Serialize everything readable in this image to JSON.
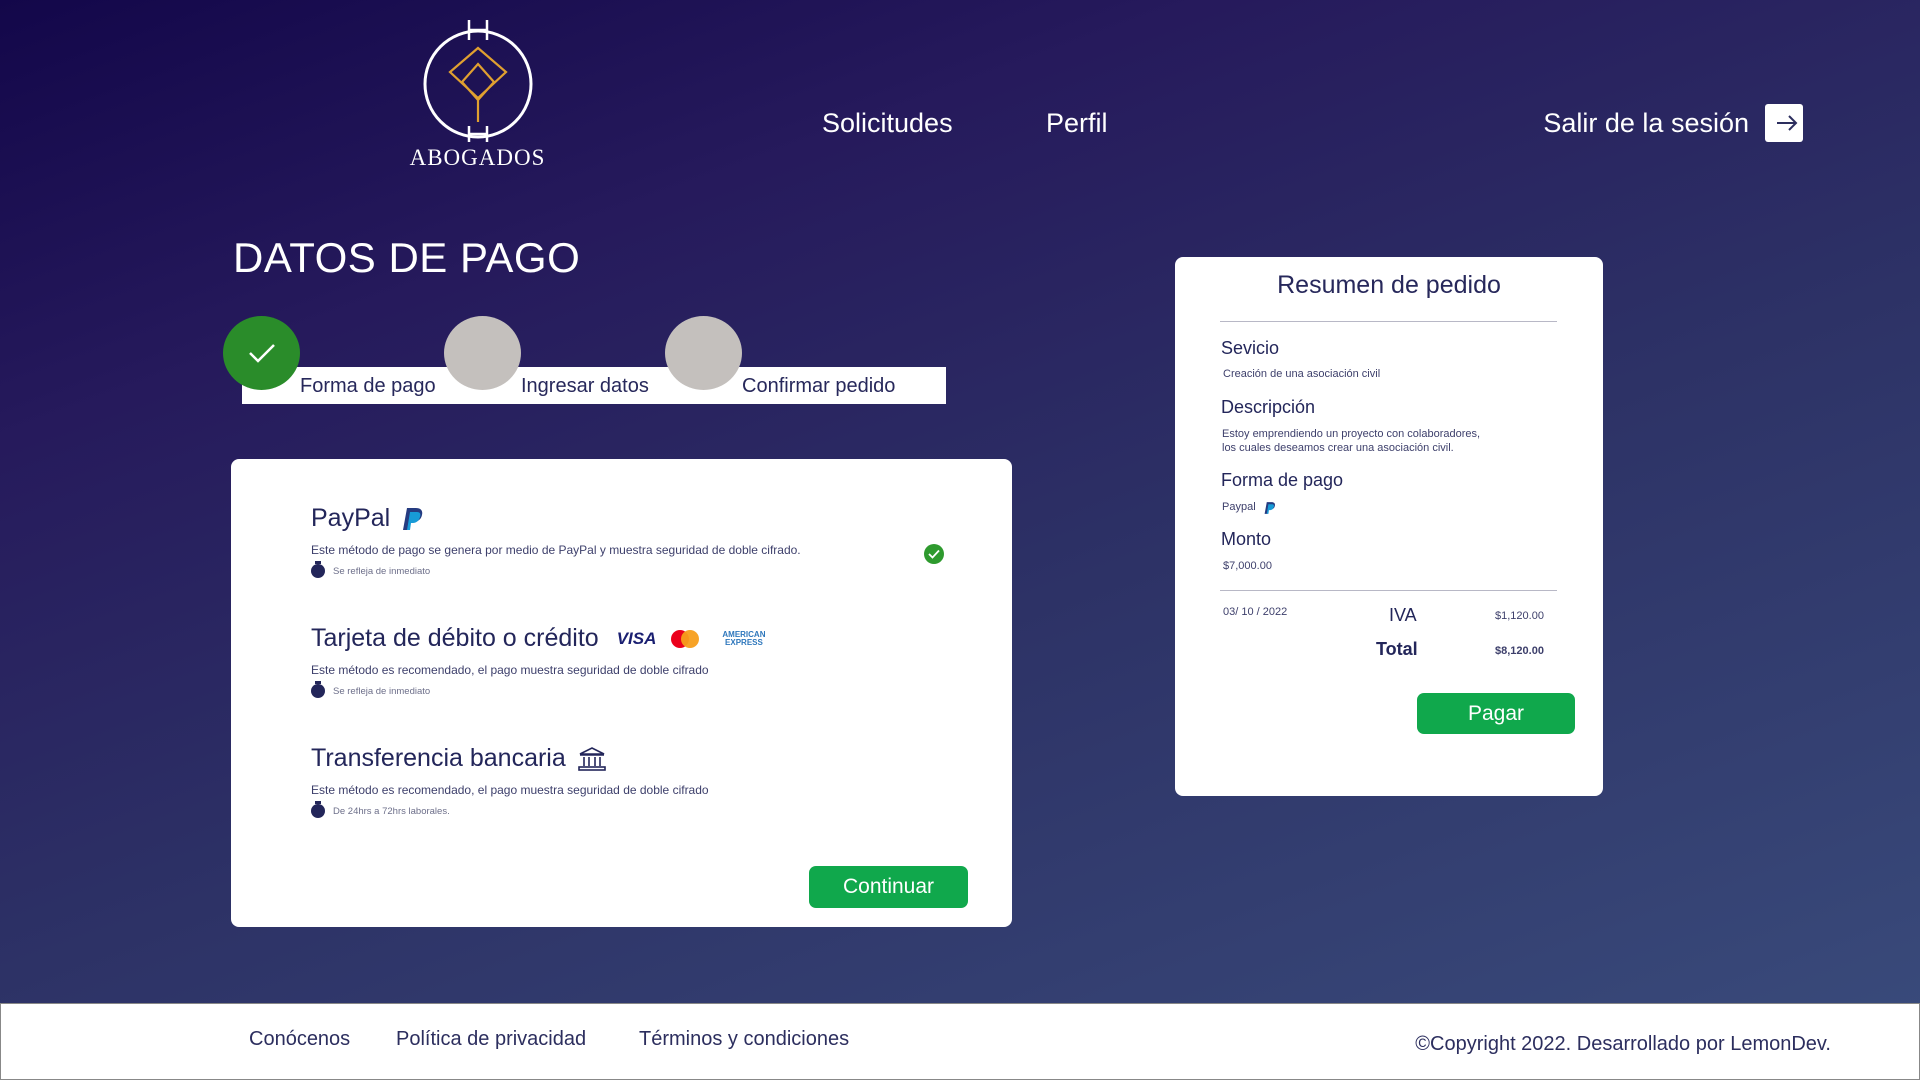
{
  "header": {
    "logo_text": "ABOGADOS",
    "nav": [
      "Solicitudes",
      "Perfil"
    ],
    "logout_label": "Salir de la sesión"
  },
  "page_title": "DATOS DE PAGO",
  "stepper": {
    "steps": [
      "Forma de pago",
      "Ingresar datos",
      "Confirmar pedido"
    ],
    "completed_steps": 1
  },
  "payment_methods": [
    {
      "title": "PayPal",
      "icon": "paypal-icon",
      "description": "Este método de pago se genera por medio  de PayPal y muestra seguridad de doble cifrado.",
      "note": "Se refleja de inmediato",
      "selected": true
    },
    {
      "title": "Tarjeta de débito o crédito",
      "icon": "card-brands-icons",
      "brands": [
        "VISA",
        "AMERICAN",
        "EXPRESS"
      ],
      "description": "Este método es recomendado, el pago muestra seguridad de doble cifrado",
      "note": "Se refleja de inmediato",
      "selected": false
    },
    {
      "title": "Transferencia bancaria",
      "icon": "bank-icon",
      "description": "Este método es recomendado, el pago muestra seguridad de doble cifrado",
      "note": "De 24hrs a 72hrs laborales.",
      "selected": false
    }
  ],
  "continue_label": "Continuar",
  "summary": {
    "title": "Resumen de pedido",
    "service_label": "Sevicio",
    "service_value": "Creación de una asociación civil",
    "description_label": "Descripción",
    "description_line1": "Estoy emprendiendo un proyecto con colaboradores,",
    "description_line2": "los cuales deseamos crear una asociación civil.",
    "payment_label": "Forma de pago",
    "payment_value": "Paypal",
    "amount_label": "Monto",
    "amount_value": "$7,000.00",
    "date": "03/ 10 / 2022",
    "iva_label": "IVA",
    "iva_value": "$1,120.00",
    "total_label": "Total",
    "total_value": "$8,120.00",
    "pay_label": "Pagar"
  },
  "footer": {
    "links": [
      "Conócenos",
      "Política de privacidad",
      "Términos y condiciones"
    ],
    "copyright_symbol": "©",
    "copyright": "Copyright 2022. Desarrollado por LemonDev."
  },
  "colors": {
    "accent_green": "#10a84c",
    "step_done": "#2a8c2a",
    "step_pending": "#c4c0bd",
    "text_dark": "#23265a",
    "logo_gold": "#e0a030"
  }
}
